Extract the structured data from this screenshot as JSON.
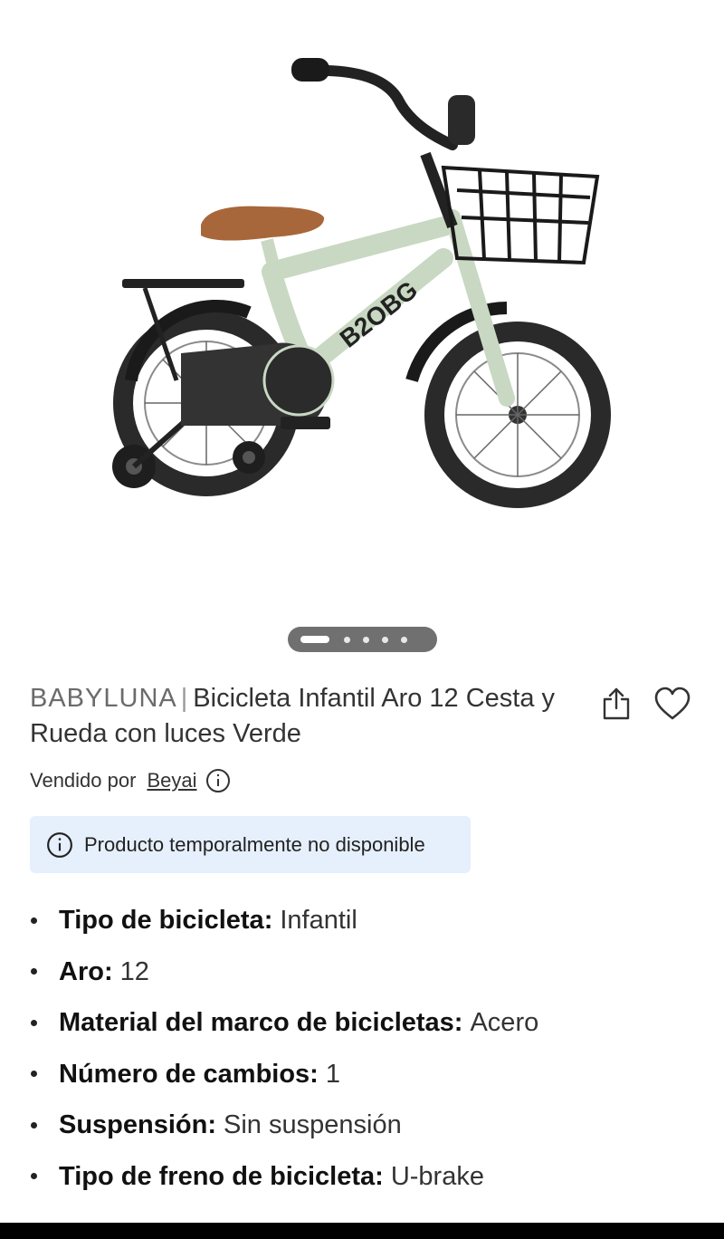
{
  "product": {
    "brand": "BABYLUNA",
    "separator": "|",
    "name": "Bicicleta Infantil Aro 12 Cesta y Rueda con luces Verde",
    "image_description": "green children's bicycle with basket and training wheels",
    "frame_text": "B2OBG",
    "images_total": 5,
    "images_active": 1
  },
  "seller": {
    "prefix": "Vendido por",
    "name": "Beyai"
  },
  "notice": {
    "text": "Producto temporalmente no disponible"
  },
  "specs": [
    {
      "label": "Tipo de bicicleta:",
      "value": "Infantil"
    },
    {
      "label": "Aro:",
      "value": "12"
    },
    {
      "label": "Material del marco de bicicletas:",
      "value": "Acero"
    },
    {
      "label": "Número de cambios:",
      "value": "1"
    },
    {
      "label": "Suspensión:",
      "value": "Sin suspensión"
    },
    {
      "label": "Tipo de freno de bicicleta:",
      "value": "U-brake"
    }
  ],
  "icons": {
    "share": "share-icon",
    "favorite": "heart-icon",
    "info": "info-icon"
  },
  "colors": {
    "frame": "#c9d8c2",
    "notice_bg": "#e6effc",
    "saddle": "#a8673a"
  }
}
